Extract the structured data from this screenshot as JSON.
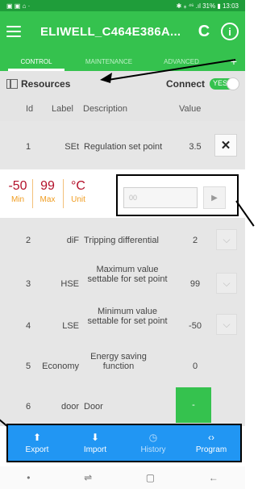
{
  "statusbar": {
    "left_icons": "▣ ▣ ⌂ ·",
    "right": "✱ ⁎ ⁴⁶ .ıl 31% ▮ 13:03"
  },
  "appbar": {
    "title": "ELIWELL_C464E386A...",
    "refresh_glyph": "C",
    "info_glyph": "i"
  },
  "tabs": [
    {
      "label": "CONTROL"
    },
    {
      "label": "MAINTENANCE"
    },
    {
      "label": "ADVANCED"
    }
  ],
  "tab_plus": "+",
  "resources": {
    "label": "Resources",
    "connect_label": "Connect",
    "toggle_text": "YES"
  },
  "table": {
    "headers": {
      "id": "Id",
      "label": "Label",
      "description": "Description",
      "value": "Value"
    },
    "rows": [
      {
        "id": "1",
        "label": "SEt",
        "description": "Regulation set point",
        "value": "3.5"
      },
      {
        "id": "2",
        "label": "diF",
        "description": "Tripping differential",
        "value": "2"
      },
      {
        "id": "3",
        "label": "HSE",
        "description": "Maximum value settable for set point",
        "value": "99"
      },
      {
        "id": "4",
        "label": "LSE",
        "description": "Minimum value settable for set point",
        "value": "-50"
      },
      {
        "id": "5",
        "label": "Economy",
        "description": "Energy saving function",
        "value": "0"
      },
      {
        "id": "6",
        "label": "door",
        "description": "Door",
        "value": "-"
      }
    ]
  },
  "editor": {
    "min": "-50",
    "min_caption": "Min",
    "max": "99",
    "max_caption": "Max",
    "unit": "°C",
    "unit_caption": "Unit",
    "placeholder": "00",
    "send_glyph": "▶"
  },
  "close_glyph": "✕",
  "chevron_glyph": "⌵",
  "bottomnav": [
    {
      "label": "Export",
      "icon": "export-icon",
      "glyph": "⬆"
    },
    {
      "label": "Import",
      "icon": "import-icon",
      "glyph": "⬇"
    },
    {
      "label": "History",
      "icon": "history-icon",
      "glyph": "◷"
    },
    {
      "label": "Program",
      "icon": "program-icon",
      "glyph": "‹›"
    }
  ],
  "sysnav": {
    "dot": "•",
    "recent": "⇌",
    "home": "▢",
    "back": "←"
  },
  "colors": {
    "primary_green": "#35c24e",
    "dark_green": "#1f9d3a",
    "nav_blue": "#2196f3",
    "min_red": "#b3102a",
    "caption_orange": "#f09d22"
  }
}
